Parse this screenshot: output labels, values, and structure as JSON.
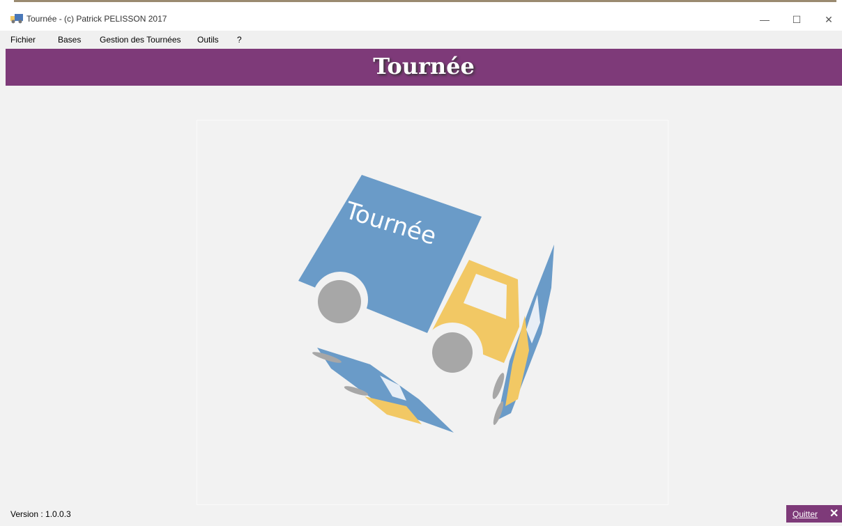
{
  "window": {
    "title": "Tournée - (c) Patrick PELISSON 2017",
    "minimize_glyph": "—",
    "maximize_glyph": "☐",
    "close_glyph": "✕"
  },
  "menu": {
    "items": [
      "Fichier",
      "Bases",
      "Gestion des Tournées",
      "Outils",
      "?"
    ]
  },
  "banner": {
    "title": "Tournée"
  },
  "logo": {
    "truck_text": "Tournée",
    "colors": {
      "truck_box": "#6a9bc8",
      "cab": "#f2c864",
      "wheel": "#a7a7a7",
      "banner": "#7e3a79"
    }
  },
  "footer": {
    "version": "Version : 1.0.0.3",
    "quit_label": "Quitter",
    "quit_icon": "✕"
  }
}
